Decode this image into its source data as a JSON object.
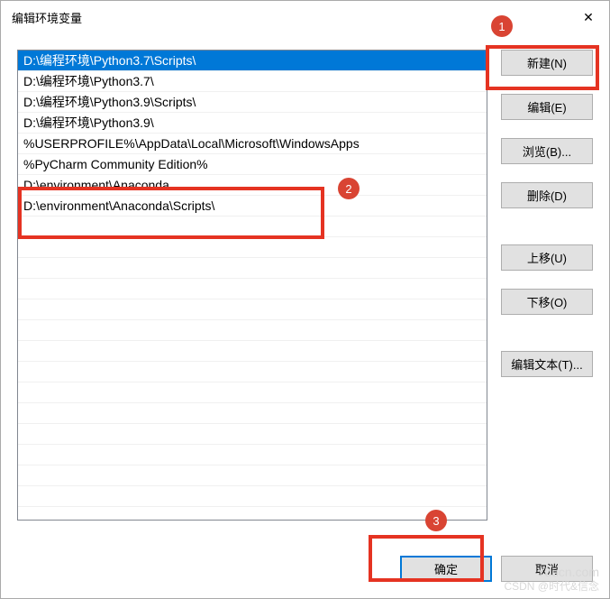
{
  "window": {
    "title": "编辑环境变量"
  },
  "list": {
    "items": [
      {
        "text": "D:\\编程环境\\Python3.7\\Scripts\\",
        "selected": true
      },
      {
        "text": "D:\\编程环境\\Python3.7\\",
        "selected": false
      },
      {
        "text": "D:\\编程环境\\Python3.9\\Scripts\\",
        "selected": false
      },
      {
        "text": "D:\\编程环境\\Python3.9\\",
        "selected": false
      },
      {
        "text": "%USERPROFILE%\\AppData\\Local\\Microsoft\\WindowsApps",
        "selected": false
      },
      {
        "text": "%PyCharm Community Edition%",
        "selected": false
      },
      {
        "text": "D:\\environment\\Anaconda",
        "selected": false
      },
      {
        "text": "D:\\environment\\Anaconda\\Scripts\\",
        "selected": false
      }
    ]
  },
  "buttons": {
    "new": "新建(N)",
    "edit": "编辑(E)",
    "browse": "浏览(B)...",
    "delete": "删除(D)",
    "moveup": "上移(U)",
    "movedown": "下移(O)",
    "edittext": "编辑文本(T)...",
    "ok": "确定",
    "cancel": "取消"
  },
  "annotations": {
    "badge1": "1",
    "badge2": "2",
    "badge3": "3"
  },
  "watermark": {
    "line1": "Yuucn.com",
    "line2": "CSDN @时代&信念"
  }
}
